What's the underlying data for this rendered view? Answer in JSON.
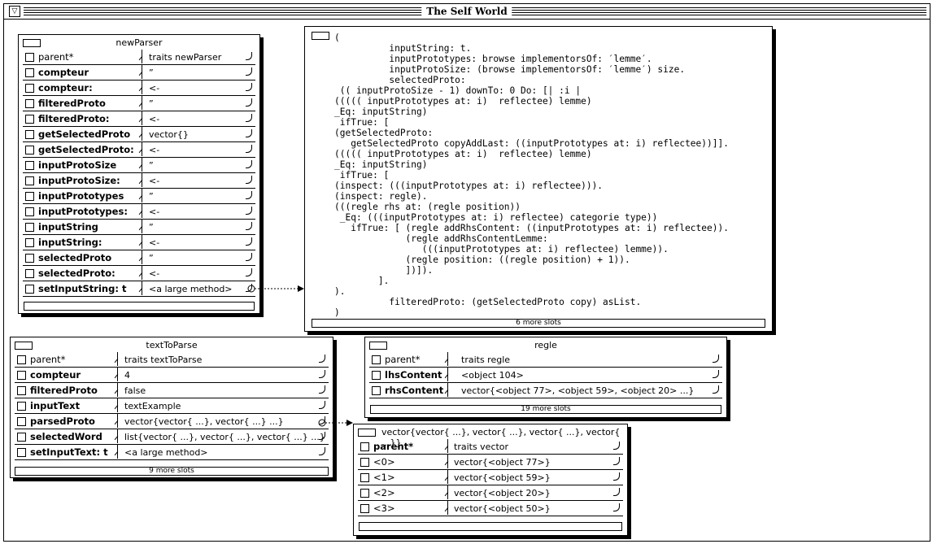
{
  "world": {
    "title": "The Self World"
  },
  "newParser": {
    "title": "newParser",
    "slots": [
      {
        "name": "parent*",
        "bold": false,
        "value": "traits newParser"
      },
      {
        "name": "compteur",
        "bold": true,
        "value": "”"
      },
      {
        "name": "compteur:",
        "bold": true,
        "value": "<-"
      },
      {
        "name": "filteredProto",
        "bold": true,
        "value": "”"
      },
      {
        "name": "filteredProto:",
        "bold": true,
        "value": "<-"
      },
      {
        "name": "getSelectedProto",
        "bold": true,
        "value": "vector{}"
      },
      {
        "name": "getSelectedProto:",
        "bold": true,
        "value": "<-"
      },
      {
        "name": "inputProtoSize",
        "bold": true,
        "value": "”"
      },
      {
        "name": "inputProtoSize:",
        "bold": true,
        "value": "<-"
      },
      {
        "name": "inputPrototypes",
        "bold": true,
        "value": "”"
      },
      {
        "name": "inputPrototypes:",
        "bold": true,
        "value": "<-"
      },
      {
        "name": "inputString",
        "bold": true,
        "value": "”"
      },
      {
        "name": "inputString:",
        "bold": true,
        "value": "<-"
      },
      {
        "name": "selectedProto",
        "bold": true,
        "value": "”"
      },
      {
        "name": "selectedProto:",
        "bold": true,
        "value": "<-"
      },
      {
        "name": "setInputString: t",
        "bold": true,
        "value": "<a large method>"
      }
    ]
  },
  "method": {
    "code": "(\n          inputString: t.\n          inputPrototypes: browse implementorsOf: ′lemme′.\n          inputProtoSize: (browse implementorsOf: ′lemme′) size.\n          selectedProto:\n (( inputProtoSize - 1) downTo: 0 Do: [| :i |\n((((( inputPrototypes at: i)  reflectee) lemme)\n_Eq: inputString)\n ifTrue: [\n(getSelectedProto:\n   getSelectedProto copyAddLast: ((inputPrototypes at: i) reflectee))]].\n((((( inputPrototypes at: i)  reflectee) lemme)\n_Eq: inputString)\n ifTrue: [\n(inspect: (((inputPrototypes at: i) reflectee))).\n(inspect: regle).\n(((regle rhs at: (regle position))\n _Eq: (((inputPrototypes at: i) reflectee) categorie type))\n   ifTrue: [ (regle addRhsContent: ((inputPrototypes at: i) reflectee)).\n             (regle addRhsContentLemme:\n                (((inputPrototypes at: i) reflectee) lemme)).\n             (regle position: ((regle position) + 1)).\n             ])]).\n        ].\n).\n          filteredProto: (getSelectedProto copy) asList.\n)",
    "more": "6 more slots"
  },
  "textToParse": {
    "title": "textToParse",
    "slots": [
      {
        "name": "parent*",
        "bold": false,
        "value": "traits textToParse"
      },
      {
        "name": "compteur",
        "bold": true,
        "value": "4"
      },
      {
        "name": "filteredProto",
        "bold": true,
        "value": "false"
      },
      {
        "name": "inputText",
        "bold": true,
        "value": "textExample"
      },
      {
        "name": "parsedProto",
        "bold": true,
        "value": "vector{vector{ ...}, vector{ ...} ...}"
      },
      {
        "name": "selectedWord",
        "bold": true,
        "value": "list{vector{ ...}, vector{ ...}, vector{ ...} ...}"
      },
      {
        "name": "setInputText: t",
        "bold": true,
        "value": "<a large method>"
      }
    ],
    "more": "9 more slots"
  },
  "regle": {
    "title": "regle",
    "slots": [
      {
        "name": "parent*",
        "bold": false,
        "value": "traits regle"
      },
      {
        "name": "lhsContent",
        "bold": true,
        "value": "<object 104>"
      },
      {
        "name": "rhsContent",
        "bold": true,
        "value": "vector{<object 77>, <object 59>, <object 20> ...}"
      }
    ],
    "more": "19 more slots"
  },
  "vector": {
    "title": "vector{vector{ ...}, vector{ ...}, vector{ ...}, vector{ ...}}",
    "slots": [
      {
        "name": "parent*",
        "bold": true,
        "value": "traits vector"
      },
      {
        "name": "<0>",
        "bold": false,
        "value": "vector{<object 77>}"
      },
      {
        "name": "<1>",
        "bold": false,
        "value": "vector{<object 59>}"
      },
      {
        "name": "<2>",
        "bold": false,
        "value": "vector{<object 20>}"
      },
      {
        "name": "<3>",
        "bold": false,
        "value": "vector{<object 50>}"
      }
    ]
  }
}
